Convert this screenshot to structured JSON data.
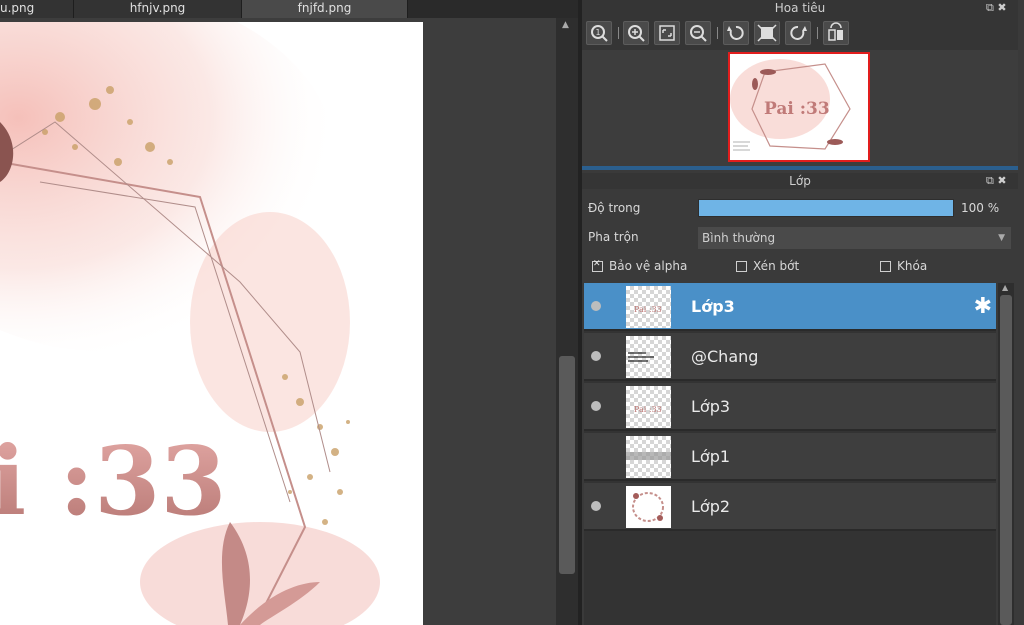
{
  "tabs": [
    {
      "label": "u.png",
      "active": false
    },
    {
      "label": "hfnjv.png",
      "active": false
    },
    {
      "label": "fnjfd.png",
      "active": true
    }
  ],
  "canvas": {
    "artwork_text": "i :33",
    "accent_color": "#c98c8a"
  },
  "navigator": {
    "title": "Hoa tiêu",
    "controls": "⧉ ✖",
    "toolbar_icons": [
      "zoom-actual-icon",
      "zoom-in-icon",
      "fit-screen-icon",
      "zoom-out-icon",
      "rotate-left-icon",
      "reset-view-icon",
      "rotate-right-icon",
      "flip-icon"
    ],
    "thumb_text": "Pai :33"
  },
  "layers_panel": {
    "title": "Lớp",
    "controls": "⧉ ✖",
    "opacity_label": "Độ trong",
    "opacity_value": "100 %",
    "opacity_fraction": 1.0,
    "blend_label": "Pha trộn",
    "blend_value": "Bình thường",
    "checkboxes": [
      {
        "label": "Bảo vệ alpha",
        "checked": true
      },
      {
        "label": "Xén bớt",
        "checked": false
      },
      {
        "label": "Khóa",
        "checked": false
      }
    ],
    "layers": [
      {
        "name": "Lớp3",
        "visible": true,
        "selected": true
      },
      {
        "name": "@Chang",
        "visible": true,
        "selected": false
      },
      {
        "name": "Lớp3",
        "visible": true,
        "selected": false
      },
      {
        "name": "Lớp1",
        "visible": false,
        "selected": false
      },
      {
        "name": "Lớp2",
        "visible": true,
        "selected": false
      }
    ]
  },
  "colors": {
    "selection": "#4a90c8",
    "slider_fill": "#6fb4e6",
    "nav_frame": "#e21d1d"
  }
}
